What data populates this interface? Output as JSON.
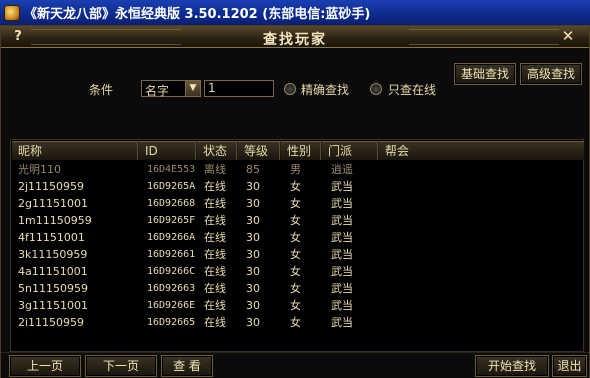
{
  "window": {
    "title": "《新天龙八部》永恒经典版 3.50.1202 (东部电信:蓝砂手)"
  },
  "dialog": {
    "title": "查找玩家",
    "help": "?",
    "close": "✕"
  },
  "top_buttons": {
    "basic_search": "基础查找",
    "advanced_search": "高级查找"
  },
  "condition": {
    "label": "条件",
    "select_value": "名字",
    "input_value": "1",
    "radio_exact": "精确查找",
    "radio_online": "只查在线"
  },
  "table": {
    "headers": [
      "昵称",
      "ID",
      "状态",
      "等级",
      "性别",
      "门派",
      "帮会"
    ],
    "rows": [
      {
        "name": "光明110",
        "id": "16D4E553",
        "status": "离线",
        "level": "85",
        "gender": "男",
        "sect": "逍遥",
        "guild": ""
      },
      {
        "name": "2j11150959",
        "id": "16D9265A",
        "status": "在线",
        "level": "30",
        "gender": "女",
        "sect": "武当",
        "guild": ""
      },
      {
        "name": "2g11151001",
        "id": "16D92668",
        "status": "在线",
        "level": "30",
        "gender": "女",
        "sect": "武当",
        "guild": ""
      },
      {
        "name": "1m11150959",
        "id": "16D9265F",
        "status": "在线",
        "level": "30",
        "gender": "女",
        "sect": "武当",
        "guild": ""
      },
      {
        "name": "4f11151001",
        "id": "16D9266A",
        "status": "在线",
        "level": "30",
        "gender": "女",
        "sect": "武当",
        "guild": ""
      },
      {
        "name": "3k11150959",
        "id": "16D92661",
        "status": "在线",
        "level": "30",
        "gender": "女",
        "sect": "武当",
        "guild": ""
      },
      {
        "name": "4a11151001",
        "id": "16D9266C",
        "status": "在线",
        "level": "30",
        "gender": "女",
        "sect": "武当",
        "guild": ""
      },
      {
        "name": "5n11150959",
        "id": "16D92663",
        "status": "在线",
        "level": "30",
        "gender": "女",
        "sect": "武当",
        "guild": ""
      },
      {
        "name": "3g11151001",
        "id": "16D9266E",
        "status": "在线",
        "level": "30",
        "gender": "女",
        "sect": "武当",
        "guild": ""
      },
      {
        "name": "2i11150959",
        "id": "16D92665",
        "status": "在线",
        "level": "30",
        "gender": "女",
        "sect": "武当",
        "guild": ""
      }
    ]
  },
  "bottom_buttons": {
    "prev_page": "上一页",
    "next_page": "下一页",
    "view": "查 看",
    "start_search": "开始查找",
    "exit": "退出"
  }
}
